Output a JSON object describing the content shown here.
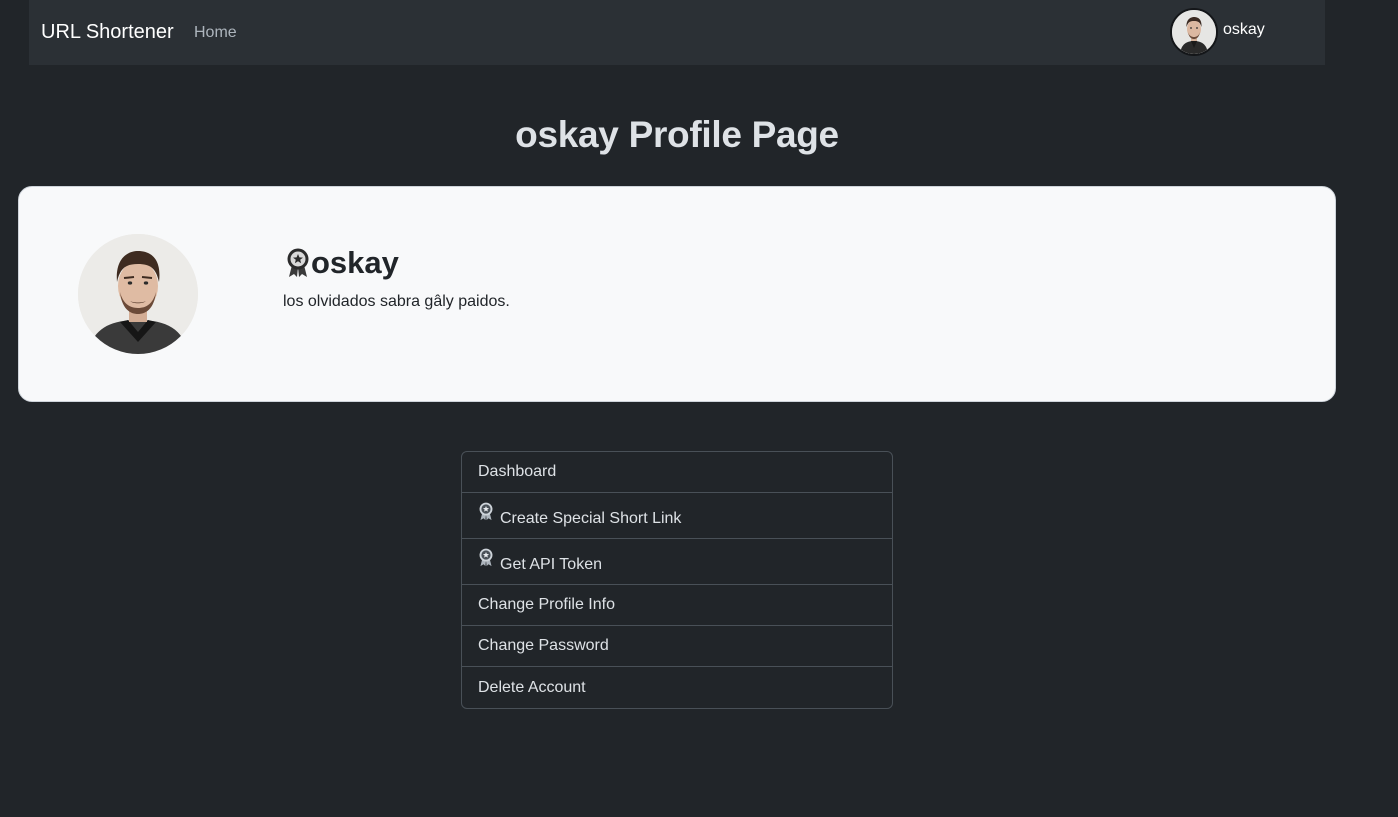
{
  "navbar": {
    "brand": "URL Shortener",
    "home": "Home",
    "username": "oskay",
    "avatar_icon": "user-avatar-photo"
  },
  "page": {
    "title": "oskay Profile Page"
  },
  "profile": {
    "username": "oskay",
    "bio": "los olvidados sabra gâly paidos.",
    "badge_icon": "premium-badge-icon",
    "avatar_icon": "profile-photo"
  },
  "menu": {
    "items": [
      {
        "label": "Dashboard",
        "special": false
      },
      {
        "label": "Create Special Short Link",
        "special": true
      },
      {
        "label": "Get API Token",
        "special": true
      },
      {
        "label": "Change Profile Info",
        "special": false
      },
      {
        "label": "Change Password",
        "special": false
      },
      {
        "label": "Delete Account",
        "special": false
      }
    ]
  },
  "colors": {
    "background": "#212529",
    "navbar": "#2b3035",
    "card": "#f8f9fa",
    "border": "#495057",
    "text_light": "#dee2e6",
    "text_dark": "#212529"
  }
}
